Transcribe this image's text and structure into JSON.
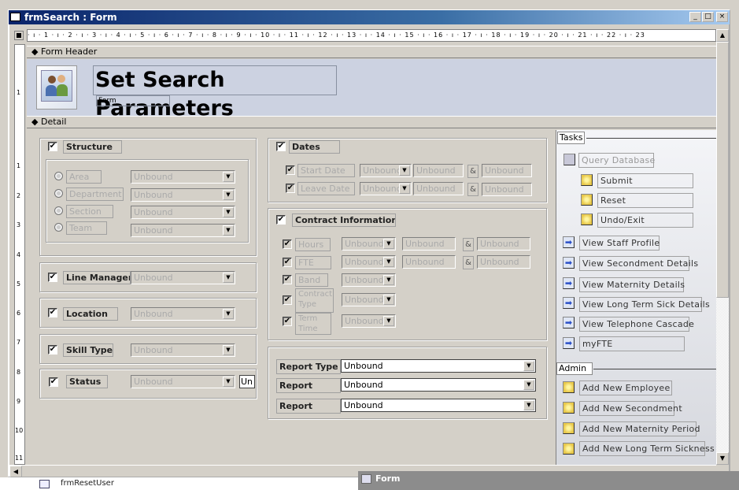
{
  "window": {
    "title": "frmSearch : Form",
    "min": "_",
    "max": "□",
    "close": "×"
  },
  "ruler": "· ı · 1 · ı · 2 · ı · 3 · ı · 4 · ı · 5 · ı · 6 · ı · 7 · ı · 8 · ı · 9 · ı · 10 · ı · 11 · ı · 12 · ı · 13 · ı · 14 · ı · 15 · ı · 16 · ı · 17 · ı · 18 · ı · 19 · ı · 20 · ı · 21 · ı · 22 · ı · 23",
  "vruler": [
    "1",
    "2",
    "3",
    "4",
    "5",
    "6",
    "7",
    "8",
    "9",
    "10",
    "11"
  ],
  "sections": {
    "header": "Form Header",
    "detail": "Detail"
  },
  "header": {
    "title": "Set Search Parameters",
    "subtitle": "Form"
  },
  "left": {
    "structure": "Structure",
    "structure_items": [
      {
        "label": "Area",
        "value": "Unbound"
      },
      {
        "label": "Department",
        "value": "Unbound"
      },
      {
        "label": "Section",
        "value": "Unbound"
      },
      {
        "label": "Team",
        "value": "Unbound"
      }
    ],
    "line_manager": {
      "label": "Line Manager",
      "value": "Unbound"
    },
    "location": {
      "label": "Location",
      "value": "Unbound"
    },
    "skill_type": {
      "label": "Skill Type",
      "value": "Unbound"
    },
    "status": {
      "label": "Status",
      "value": "Unbound",
      "extra": "Un"
    }
  },
  "dates": {
    "title": "Dates",
    "rows": [
      {
        "label": "Start Date",
        "op": "Unbound",
        "from": "Unbound",
        "amp": "&",
        "to": "Unbound"
      },
      {
        "label": "Leave Date",
        "op": "Unbound",
        "from": "Unbound",
        "amp": "&",
        "to": "Unbound"
      }
    ]
  },
  "contract": {
    "title": "Contract Information",
    "rows": [
      {
        "label": "Hours",
        "op": "Unbound",
        "from": "Unbound",
        "amp": "&",
        "to": "Unbound"
      },
      {
        "label": "FTE",
        "op": "Unbound",
        "from": "Unbound",
        "amp": "&",
        "to": "Unbound"
      },
      {
        "label": "Band",
        "op": "Unbound"
      },
      {
        "label": "Contract Type",
        "op": "Unbound"
      },
      {
        "label": "Term Time",
        "op": "Unbound"
      }
    ]
  },
  "report": [
    {
      "label": "Report Type",
      "value": "Unbound"
    },
    {
      "label": "Report",
      "value": "Unbound"
    },
    {
      "label": "Report",
      "value": "Unbound"
    }
  ],
  "tasks": {
    "title": "Tasks",
    "query": "Query Database",
    "sub": [
      "Submit",
      "Reset",
      "Undo/Exit"
    ],
    "views": [
      "View Staff Profile",
      "View Secondment Details",
      "View Maternity Details",
      "View Long Term Sick Details",
      "View Telephone Cascade",
      "myFTE"
    ]
  },
  "admin": {
    "title": "Admin",
    "items": [
      "Add New Employee",
      "Add New Secondment",
      "Add New Maternity Period",
      "Add New Long Term Sickness"
    ]
  },
  "bottom": {
    "list_item": "frmResetUser",
    "form_window": "Form"
  },
  "check": "✔"
}
